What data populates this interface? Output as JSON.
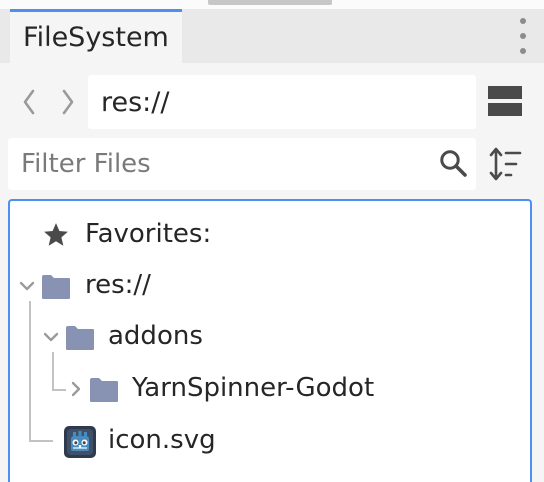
{
  "panel": {
    "tab_label": "FileSystem"
  },
  "navigation": {
    "back_icon": "chevron-left-icon",
    "forward_icon": "chevron-right-icon",
    "path": "res://",
    "layout_toggle_icon": "split-layout-icon"
  },
  "filter": {
    "placeholder": "Filter Files",
    "value": "",
    "search_icon": "search-icon",
    "sort_icon": "sort-icon"
  },
  "tree": {
    "favorites_label": "Favorites:",
    "items": [
      {
        "label": "res://",
        "type": "folder",
        "expanded": true,
        "depth": 0
      },
      {
        "label": "addons",
        "type": "folder",
        "expanded": true,
        "depth": 1
      },
      {
        "label": "YarnSpinner-Godot",
        "type": "folder",
        "expanded": false,
        "depth": 2
      },
      {
        "label": "icon.svg",
        "type": "file",
        "depth": 1
      }
    ]
  },
  "colors": {
    "accent": "#4f8ff0",
    "folder": "#8893b4",
    "text": "#262626",
    "placeholder": "#7a7a7a",
    "icon_dark": "#4a4a4a"
  }
}
